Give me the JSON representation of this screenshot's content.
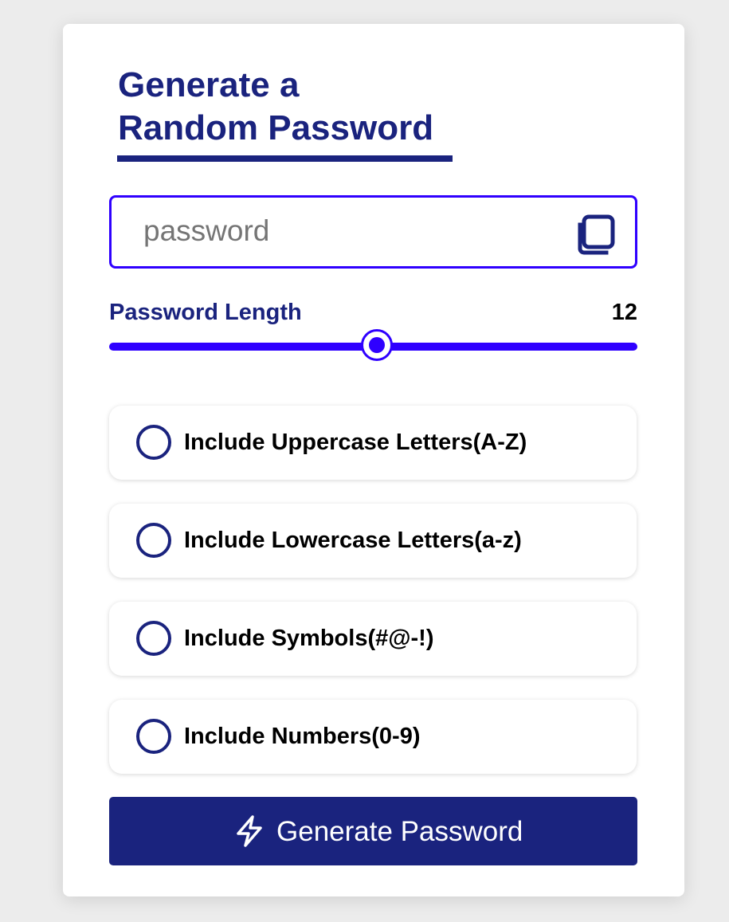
{
  "title": {
    "line1": "Generate a",
    "line2": "Random Password"
  },
  "password": {
    "value": "",
    "placeholder": "password",
    "copy_icon": "copy-icon"
  },
  "length": {
    "label": "Password Length",
    "value": "12",
    "slider_fraction": 0.5
  },
  "options": [
    {
      "label": "Include Uppercase Letters(A-Z)",
      "checked": false
    },
    {
      "label": "Include Lowercase Letters(a-z)",
      "checked": false
    },
    {
      "label": "Include Symbols(#@-!)",
      "checked": false
    },
    {
      "label": "Include Numbers(0-9)",
      "checked": false
    }
  ],
  "generate_button": {
    "label": "Generate Password",
    "icon": "lightning-bolt-icon"
  },
  "colors": {
    "navy": "#1a237e",
    "accent": "#2f00ff",
    "background": "#ececec",
    "card": "#ffffff"
  }
}
